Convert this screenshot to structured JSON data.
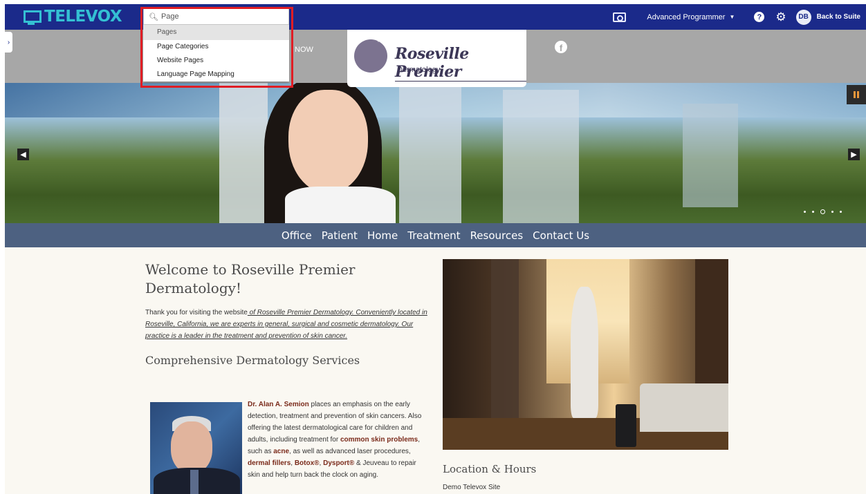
{
  "app": {
    "logo_text": "TELEVOX",
    "user_role": "Advanced Programmer",
    "avatar_initials": "DB",
    "back_to_suite": "Back to Suite",
    "accent_color": "#1b2a8a",
    "logo_color": "#34c0d3"
  },
  "search": {
    "value": "Page",
    "section_header": "Pages",
    "results": [
      "Page Categories",
      "Website Pages",
      "Language Page Mapping"
    ]
  },
  "site": {
    "header_link_fragment": "NOW",
    "brand_name": "Roseville Premier",
    "brand_sub": "Dermatology",
    "nav": [
      "Office",
      "Patient",
      "Home",
      "Treatment",
      "Resources",
      "Contact Us"
    ],
    "welcome_title": "Welcome to Roseville Premier Dermatology!",
    "intro_plain": "Thank you for visiting the website",
    "intro_link": " of Roseville Premier Dermatology. Conveniently located in Roseville, California, we are experts in general, surgical and cosmetic dermatology. Our practice is a leader in the treatment and prevention of skin cancer.",
    "services_heading": "Comprehensive Dermatology Services",
    "doctor": {
      "name": "Dr. Alan A. Semion",
      "text1": " places an emphasis on the early detection, treatment and prevention of skin cancers. Also offering the latest dermatological care for children and adults, including treatment for ",
      "link1": "common skin problems",
      "text2": ", such as ",
      "link2": "acne",
      "text3": ", as well as advanced laser procedures, ",
      "link3": "dermal fillers",
      "text4": ", ",
      "link4": "Botox®",
      "text5": ", ",
      "link5": "Dysport®",
      "text6": " & Jeuveau to repair skin and help turn back the clock on aging."
    },
    "location_heading": "Location & Hours",
    "location_sub": "Demo Televox Site"
  },
  "carousel": {
    "slide_count": 5,
    "active_slide": 3
  },
  "icons": {
    "search": "search-icon",
    "preview": "monitor-preview-icon",
    "help": "help-icon",
    "settings": "gear-icon",
    "facebook": "facebook-icon",
    "pause": "pause-icon",
    "prev": "arrow-left-icon",
    "next": "arrow-right-icon",
    "sidebar": "chevron-right-icon"
  }
}
